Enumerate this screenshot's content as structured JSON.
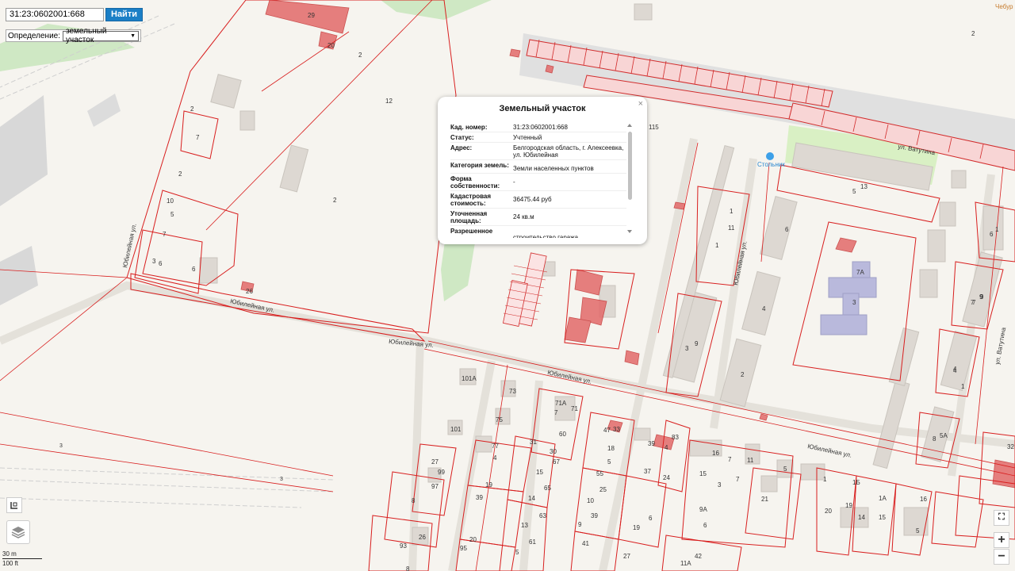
{
  "search": {
    "value": "31:23:0602001:668",
    "button_label": "Найти"
  },
  "definition": {
    "label": "Определение:",
    "selected": "земельный участок"
  },
  "popup": {
    "title": "Земельный участок",
    "rows": [
      {
        "key": "Кад. номер:",
        "value": "31:23:0602001:668"
      },
      {
        "key": "Статус:",
        "value": "Учтенный"
      },
      {
        "key": "Адрес:",
        "value": "Белгородская область, г. Алексеевка, ул. Юбилейная"
      },
      {
        "key": "Категория земель:",
        "value": "Земли населенных пунктов"
      },
      {
        "key": "Форма собственности:",
        "value": "-"
      },
      {
        "key": "Кадастровая стоимость:",
        "value": "36475.44 руб"
      },
      {
        "key": "Уточненная площадь:",
        "value": "24 кв.м"
      },
      {
        "key": "Разрешенное",
        "value": "строительство гаража"
      }
    ]
  },
  "scale": {
    "metric": "30 m",
    "imperial": "100 ft"
  },
  "map": {
    "streets": [
      "Юбилейная ул.",
      "Юбилейная ул.",
      "Юбилейная ул.",
      "Юбилейная ул.",
      "Юбилейная ул.",
      "Юбилейная ул.",
      "ул. Ватутина",
      "ул. Ватутина"
    ],
    "poi": "Стольник",
    "corner_label": "Чебур",
    "numbers": [
      "29",
      "20",
      "2",
      "2",
      "2",
      "7",
      "2",
      "10",
      "5",
      "7",
      "3",
      "6",
      "6",
      "26",
      "12",
      "115",
      "5",
      "13",
      "1",
      "11",
      "1",
      "6",
      "4",
      "2",
      "7A",
      "3",
      "4",
      "1",
      "9",
      "3",
      "9",
      "101А",
      "73",
      "75",
      "101",
      "71А",
      "71",
      "7",
      "60",
      "31",
      "30",
      "67",
      "77",
      "4",
      "15",
      "65",
      "19",
      "14",
      "39",
      "63",
      "13",
      "61",
      "20",
      "5",
      "8",
      "27",
      "99",
      "97",
      "8",
      "93",
      "26",
      "95",
      "83",
      "33",
      "39",
      "4",
      "47",
      "5",
      "18",
      "55",
      "37",
      "24",
      "25",
      "10",
      "39",
      "9",
      "41",
      "19",
      "6",
      "27",
      "16",
      "7",
      "15",
      "11",
      "5",
      "3",
      "7",
      "21",
      "9А",
      "6",
      "42",
      "11А",
      "1",
      "1Б",
      "1А",
      "19",
      "14",
      "15",
      "16",
      "5",
      "20",
      "4",
      "7",
      "8",
      "5А",
      "7",
      "9",
      "6",
      "1",
      "32",
      "2"
    ]
  }
}
